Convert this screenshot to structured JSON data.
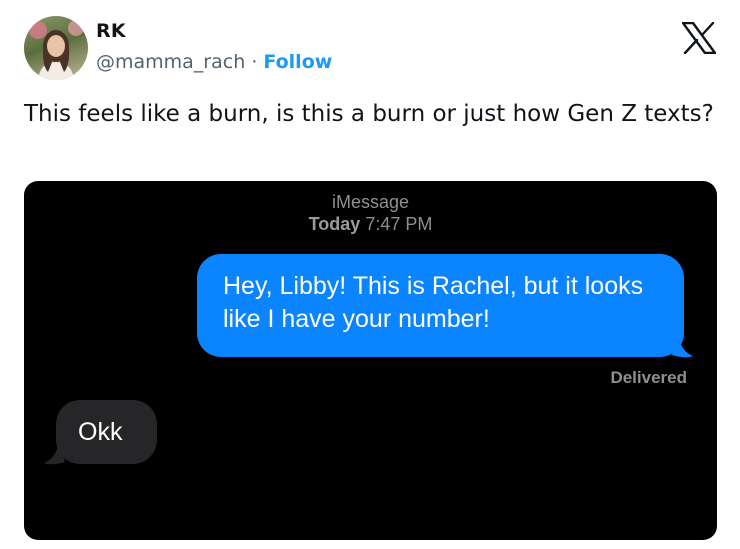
{
  "author": {
    "name": "RK",
    "handle": "@mamma_rach",
    "separator": "·",
    "follow_label": "Follow",
    "avatar_icon": "profile-photo"
  },
  "platform_icon": "x-logo-icon",
  "tweet": {
    "text": "This feels like a burn, is this a burn or just how Gen Z texts?"
  },
  "screenshot": {
    "service": "iMessage",
    "day": "Today",
    "time": "7:47 PM",
    "messages": [
      {
        "direction": "outgoing",
        "text": "Hey, Libby! This is Rachel, but it looks like I have your number!"
      },
      {
        "direction": "incoming",
        "text": "Okk"
      }
    ],
    "status": "Delivered"
  },
  "colors": {
    "follow": "#1d9bf0",
    "outgoing_bubble": "#0a84ff",
    "incoming_bubble": "#262628",
    "message_background": "#000000"
  }
}
